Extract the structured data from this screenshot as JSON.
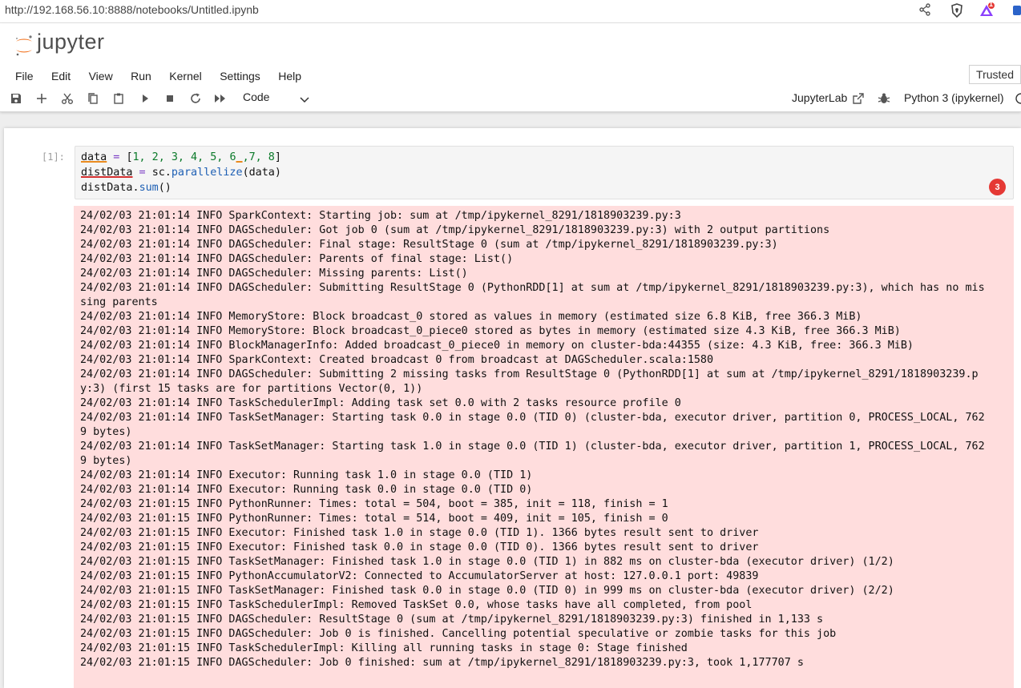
{
  "browser": {
    "url": "http://192.168.56.10:8888/notebooks/Untitled.ipynb",
    "icons": [
      "share-icon",
      "brave-shield-icon",
      "brave-rewards-icon",
      "extension-icon"
    ],
    "rewards_badge": "1"
  },
  "header": {
    "logo_text": "jupyter",
    "trusted_label": "Trusted"
  },
  "menu": [
    "File",
    "Edit",
    "View",
    "Run",
    "Kernel",
    "Settings",
    "Help"
  ],
  "toolbar": {
    "cell_type": "Code",
    "jupyterlab_label": "JupyterLab",
    "kernel_name": "Python 3 (ipykernel)"
  },
  "cell": {
    "prompt": "[1]:",
    "code": {
      "line1": {
        "var": "data",
        "op": " = ",
        "open": "[",
        "nums": "1, 2, 3, 4, 5, ",
        "n6": "6",
        "gap": " ",
        "comma7": ",7, 8",
        "close": "]"
      },
      "line2": {
        "var": "distData",
        "op": " = ",
        "obj": "sc.",
        "fn": "parallelize",
        "args": "(data)"
      },
      "line3": {
        "obj": "distData.",
        "fn": "sum",
        "args": "()"
      }
    },
    "diagnostic_count": "3",
    "output_lines": [
      "24/02/03 21:01:14 INFO SparkContext: Starting job: sum at /tmp/ipykernel_8291/1818903239.py:3",
      "24/02/03 21:01:14 INFO DAGScheduler: Got job 0 (sum at /tmp/ipykernel_8291/1818903239.py:3) with 2 output partitions",
      "24/02/03 21:01:14 INFO DAGScheduler: Final stage: ResultStage 0 (sum at /tmp/ipykernel_8291/1818903239.py:3)",
      "24/02/03 21:01:14 INFO DAGScheduler: Parents of final stage: List()",
      "24/02/03 21:01:14 INFO DAGScheduler: Missing parents: List()",
      "24/02/03 21:01:14 INFO DAGScheduler: Submitting ResultStage 0 (PythonRDD[1] at sum at /tmp/ipykernel_8291/1818903239.py:3), which has no mis",
      "sing parents",
      "24/02/03 21:01:14 INFO MemoryStore: Block broadcast_0 stored as values in memory (estimated size 6.8 KiB, free 366.3 MiB)",
      "24/02/03 21:01:14 INFO MemoryStore: Block broadcast_0_piece0 stored as bytes in memory (estimated size 4.3 KiB, free 366.3 MiB)",
      "24/02/03 21:01:14 INFO BlockManagerInfo: Added broadcast_0_piece0 in memory on cluster-bda:44355 (size: 4.3 KiB, free: 366.3 MiB)",
      "24/02/03 21:01:14 INFO SparkContext: Created broadcast 0 from broadcast at DAGScheduler.scala:1580",
      "24/02/03 21:01:14 INFO DAGScheduler: Submitting 2 missing tasks from ResultStage 0 (PythonRDD[1] at sum at /tmp/ipykernel_8291/1818903239.p",
      "y:3) (first 15 tasks are for partitions Vector(0, 1))",
      "24/02/03 21:01:14 INFO TaskSchedulerImpl: Adding task set 0.0 with 2 tasks resource profile 0",
      "24/02/03 21:01:14 INFO TaskSetManager: Starting task 0.0 in stage 0.0 (TID 0) (cluster-bda, executor driver, partition 0, PROCESS_LOCAL, 762",
      "9 bytes)",
      "24/02/03 21:01:14 INFO TaskSetManager: Starting task 1.0 in stage 0.0 (TID 1) (cluster-bda, executor driver, partition 1, PROCESS_LOCAL, 762",
      "9 bytes)",
      "24/02/03 21:01:14 INFO Executor: Running task 1.0 in stage 0.0 (TID 1)",
      "24/02/03 21:01:14 INFO Executor: Running task 0.0 in stage 0.0 (TID 0)",
      "24/02/03 21:01:15 INFO PythonRunner: Times: total = 504, boot = 385, init = 118, finish = 1",
      "24/02/03 21:01:15 INFO PythonRunner: Times: total = 514, boot = 409, init = 105, finish = 0",
      "24/02/03 21:01:15 INFO Executor: Finished task 1.0 in stage 0.0 (TID 1). 1366 bytes result sent to driver",
      "24/02/03 21:01:15 INFO Executor: Finished task 0.0 in stage 0.0 (TID 0). 1366 bytes result sent to driver",
      "24/02/03 21:01:15 INFO TaskSetManager: Finished task 1.0 in stage 0.0 (TID 1) in 882 ms on cluster-bda (executor driver) (1/2)",
      "24/02/03 21:01:15 INFO PythonAccumulatorV2: Connected to AccumulatorServer at host: 127.0.0.1 port: 49839",
      "24/02/03 21:01:15 INFO TaskSetManager: Finished task 0.0 in stage 0.0 (TID 0) in 999 ms on cluster-bda (executor driver) (2/2)",
      "24/02/03 21:01:15 INFO TaskSchedulerImpl: Removed TaskSet 0.0, whose tasks have all completed, from pool",
      "24/02/03 21:01:15 INFO DAGScheduler: ResultStage 0 (sum at /tmp/ipykernel_8291/1818903239.py:3) finished in 1,133 s",
      "24/02/03 21:01:15 INFO DAGScheduler: Job 0 is finished. Cancelling potential speculative or zombie tasks for this job",
      "24/02/03 21:01:15 INFO TaskSchedulerImpl: Killing all running tasks in stage 0: Stage finished",
      "24/02/03 21:01:15 INFO DAGScheduler: Job 0 finished: sum at /tmp/ipykernel_8291/1818903239.py:3, took 1,177707 s"
    ]
  },
  "colors": {
    "accent": "#f37726",
    "output_bg": "#ffdddd",
    "badge": "#e53935"
  }
}
